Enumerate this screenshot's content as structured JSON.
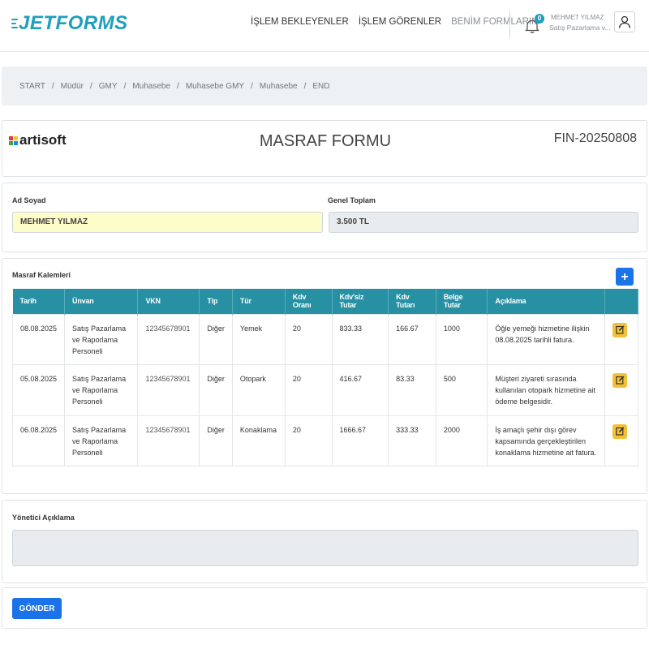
{
  "app": {
    "logo_text": "ETFORMS",
    "logo_lead": "J"
  },
  "nav": {
    "items": [
      {
        "label": "İŞLEM BEKLEYENLER"
      },
      {
        "label": "İŞLEM GÖRENLER"
      },
      {
        "label": "BENİM FORMLARIM"
      }
    ]
  },
  "notifications": {
    "count": "0"
  },
  "user": {
    "name": "MEHMET YILMAZ",
    "role": "Satış Pazarlama v..."
  },
  "breadcrumb": [
    "START",
    "Müdür",
    "GMY",
    "Muhasebe",
    "Muhasebe GMY",
    "Muhasebe",
    "END"
  ],
  "form": {
    "brand": "artisoft",
    "title": "MASRAF FORMU",
    "number": "FIN-20250808"
  },
  "info": {
    "name_label": "Ad Soyad",
    "name_value": "MEHMET YILMAZ",
    "total_label": "Genel Toplam",
    "total_value": "3.500 TL"
  },
  "expenses": {
    "title": "Masraf Kalemleri",
    "add_label": "+",
    "columns": [
      "Tarih",
      "Ünvan",
      "VKN",
      "Tip",
      "Tür",
      "Kdv Oranı",
      "Kdv'siz Tutar",
      "Kdv Tutarı",
      "Belge Tutar",
      "Açıklama"
    ],
    "rows": [
      {
        "date": "08.08.2025",
        "title": "Satış Pazarlama ve Raporlama Personeli",
        "vkn": "12345678901",
        "type": "Diğer",
        "kind": "Yemek",
        "rate": "20",
        "net": "833.33",
        "vat": "166.67",
        "amount": "1000",
        "desc": "Öğle yemeği hizmetine ilişkin 08.08.2025 tarihli fatura."
      },
      {
        "date": "05.08.2025",
        "title": "Satış Pazarlama ve Raporlama Personeli",
        "vkn": "12345678901",
        "type": "Diğer",
        "kind": "Otopark",
        "rate": "20",
        "net": "416.67",
        "vat": "83.33",
        "amount": "500",
        "desc": "Müşteri ziyareti sırasında kullanılan otopark hizmetine ait ödeme belgesidir."
      },
      {
        "date": "06.08.2025",
        "title": "Satış Pazarlama ve Raporlama Personeli",
        "vkn": "12345678901",
        "type": "Diğer",
        "kind": "Konaklama",
        "rate": "20",
        "net": "1666.67",
        "vat": "333.33",
        "amount": "2000",
        "desc": "İş amaçlı şehir dışı görev kapsamında gerçekleştirilen konaklama hizmetine ait fatura."
      }
    ]
  },
  "manager": {
    "label": "Yönetici Açıklama",
    "value": ""
  },
  "submit": {
    "label": "GÖNDER"
  },
  "colors": {
    "accent": "#2790a3",
    "primary": "#1a73e8",
    "edit": "#f4c136",
    "logo": "#1f9fbd"
  }
}
